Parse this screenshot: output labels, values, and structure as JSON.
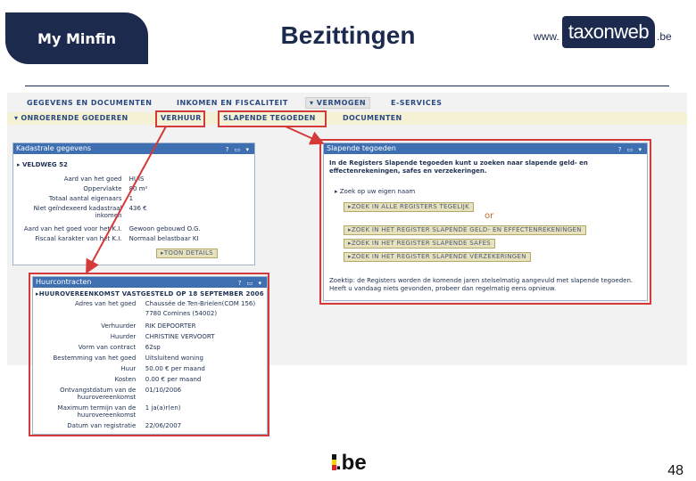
{
  "header": {
    "tab_label": "My Minfin",
    "title": "Bezittingen",
    "logo": {
      "www": "www.",
      "brand": "taxonweb",
      "tld": ".be"
    }
  },
  "nav": {
    "primary": [
      "GEGEVENS EN DOCUMENTEN",
      "INKOMEN EN FISCALITEIT",
      "▾ VERMOGEN",
      "E-SERVICES"
    ],
    "secondary": [
      "▾ ONROERENDE GOEDEREN",
      "VERHUUR",
      "SLAPENDE TEGOEDEN",
      "DOCUMENTEN"
    ]
  },
  "kadaster": {
    "title": "Kadastrale gegevens",
    "icons": "? ▭ ▾",
    "address": "▸ VELDWEG 52",
    "rows": [
      {
        "k": "Aard van het goed",
        "v": "HUIS"
      },
      {
        "k": "Oppervlakte",
        "v": "80 m²"
      },
      {
        "k": "Totaal aantal eigenaars",
        "v": "1"
      },
      {
        "k": "Niet geïndexeerd kadastraal inkomen",
        "v": "436 €"
      },
      {
        "k": "Aard van het goed voor het K.I.",
        "v": "Gewoon gebouwd O.G."
      },
      {
        "k": "Fiscaal karakter van het K.I.",
        "v": "Normaal belastbaar KI"
      }
    ],
    "details_button": "▸TOON DETAILS"
  },
  "slapend": {
    "title": "Slapende tegoeden",
    "icons": "? ▭ ▾",
    "intro": "In de Registers Slapende tegoeden kunt u zoeken naar slapende geld- en effectenrekeningen, safes en verzekeringen.",
    "search_name": "▸ Zoek op uw eigen naam",
    "buttons": [
      "▸ZOEK IN ALLE REGISTERS TEGELIJK",
      "▸ZOEK IN HET REGISTER SLAPENDE GELD- EN EFFECTENREKENINGEN",
      "▸ZOEK IN HET REGISTER SLAPENDE SAFES",
      "▸ZOEK IN HET REGISTER SLAPENDE VERZEKERINGEN"
    ],
    "or_label": "or",
    "footnote": "Zoektip: de Registers worden de komende jaren stelselmatig aangevuld met slapende tegoeden. Heeft u vandaag niets gevonden, probeer dan regelmatig eens opnieuw."
  },
  "huur": {
    "title": "Huurcontracten",
    "icons": "? ▭ ▾",
    "agreement": "▸HUUROVEREENKOMST VASTGESTELD OP 18 SEPTEMBER 2006",
    "rows": [
      {
        "k": "Adres van het goed",
        "v": "Chaussée de Ten-Brielen(COM 156)"
      },
      {
        "k": "",
        "v": "7780 Comines (54002)"
      },
      {
        "k": "Verhuurder",
        "v": "RIK DEPOORTER"
      },
      {
        "k": "Huurder",
        "v": "CHRISTINE VERVOORT"
      },
      {
        "k": "Vorm van contract",
        "v": "62sp"
      },
      {
        "k": "Bestemming van het goed",
        "v": "Uitsluitend woning"
      },
      {
        "k": "Huur",
        "v": "50.00 € per maand"
      },
      {
        "k": "Kosten",
        "v": "0.00 € per maand"
      },
      {
        "k": "Ontvangstdatum van de huurovereenkomst",
        "v": "01/10/2006"
      },
      {
        "k": "Maximum termijn van de huurovereenkomst",
        "v": "1 ja(a)r(en)"
      },
      {
        "k": "Datum van registratie",
        "v": "22/06/2007"
      }
    ]
  },
  "footer": {
    "be_logo": ".be",
    "page_number": "48"
  },
  "colors": {
    "navy": "#1c2a4e",
    "panel_header": "#3e6fb0",
    "highlight_red": "#d43a3a"
  }
}
